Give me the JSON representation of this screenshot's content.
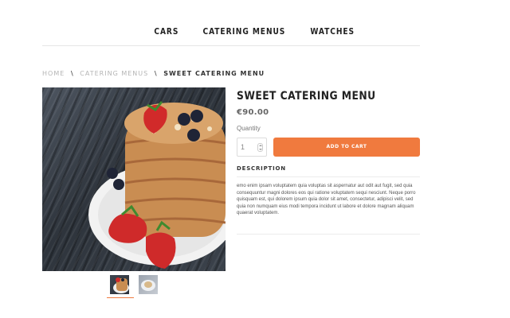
{
  "nav": {
    "items": [
      "CARS",
      "CATERING MENUS",
      "WATCHES"
    ]
  },
  "breadcrumb": {
    "home": "HOME",
    "category": "CATERING MENUS",
    "current": "SWEET CATERING MENU",
    "separator": "\\"
  },
  "product": {
    "title": "SWEET CATERING MENU",
    "price": "€90.00",
    "quantity_label": "Quantity",
    "quantity_value": "1",
    "cart_button": "ADD TO CART",
    "description_heading": "DESCRIPTION",
    "description": "emo enim ipsam voluptatem quia voluptas sit aspernatur aut odit aut fugit, sed quia consequuntur magni dolores eos qui ratione voluptatem sequi nesciunt. Neque porro quisquam est, qui dolorem ipsum quia dolor sit amet, consectetur, adipisci velit, sed quia non numquam eius modi tempora incidunt ut labore et dolore magnam aliquam quaerat voluptatem."
  },
  "gallery": {
    "thumbnails": [
      "pancake-thumb",
      "plate-thumb"
    ],
    "selected": 0
  },
  "colors": {
    "accent": "#f07a3e",
    "text": "#222222",
    "muted": "#b5b5b5"
  }
}
